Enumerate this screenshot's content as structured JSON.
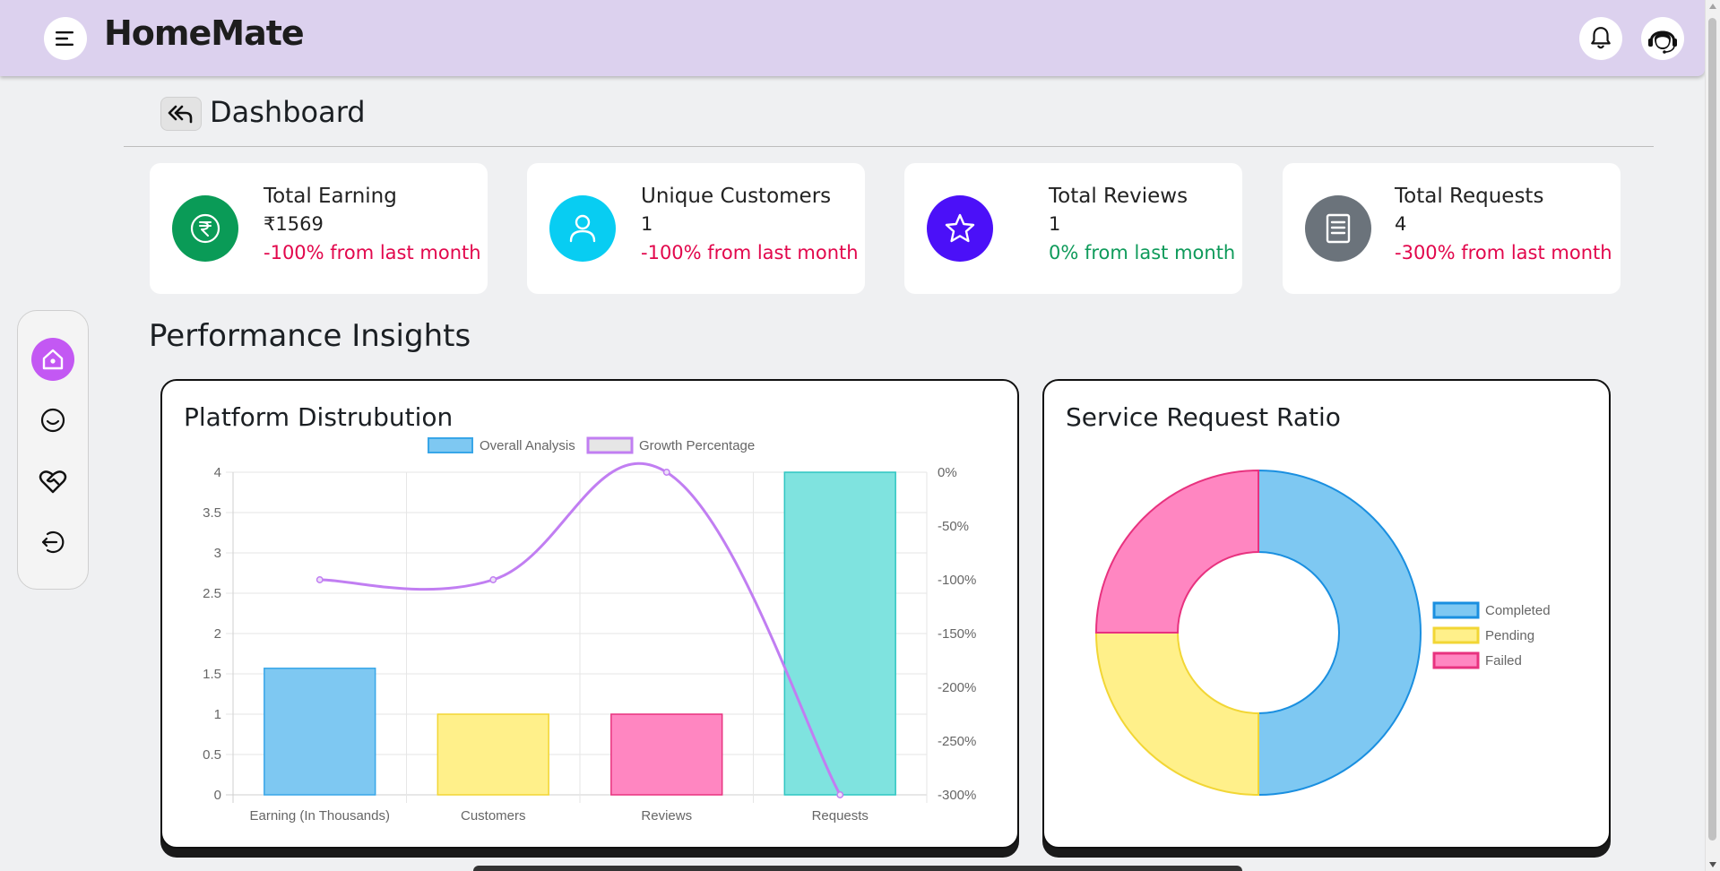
{
  "app": {
    "brand": "HomeMate"
  },
  "header": {
    "menu_icon": "hamburger-icon",
    "bell_icon": "bell-icon",
    "support_icon": "headset-avatar-icon"
  },
  "page": {
    "title": "Dashboard",
    "section_title": "Performance Insights"
  },
  "stats": [
    {
      "label": "Total Earning",
      "value": "₹1569",
      "change": "-100% from last month",
      "icon": "rupee-icon",
      "color": "#0a9b57",
      "change_color": "#e2074c"
    },
    {
      "label": "Unique Customers",
      "value": "1",
      "change": "-100% from last month",
      "icon": "user-icon",
      "color": "#08cdf2",
      "change_color": "#e2074c"
    },
    {
      "label": "Total Reviews",
      "value": "1",
      "change": "0% from last month",
      "icon": "star-icon",
      "color": "#4b10f8",
      "change_color": "#0e9a5a"
    },
    {
      "label": "Total Requests",
      "value": "4",
      "change": "-300% from last month",
      "icon": "document-icon",
      "color": "#6b737b",
      "change_color": "#e2074c"
    }
  ],
  "sidebar": {
    "items": [
      "home-icon",
      "smile-icon",
      "heart-handshake-icon",
      "logout-icon"
    ]
  },
  "charts": {
    "platform_title": "Platform Distrubution",
    "ratio_title": "Service Request Ratio"
  },
  "chart_data": [
    {
      "type": "bar",
      "title": "Platform Distrubution",
      "categories": [
        "Earning (In Thousands)",
        "Customers",
        "Reviews",
        "Requests"
      ],
      "series": [
        {
          "name": "Overall Analysis",
          "type": "bar",
          "values": [
            1.569,
            1,
            1,
            4
          ],
          "colors": [
            "#7ec8f2",
            "#fff08a",
            "#ff86c1",
            "#7fe3df"
          ],
          "borders": [
            "#38a6e8",
            "#f2d635",
            "#e8327f",
            "#2fc6c2"
          ],
          "axis": "left"
        },
        {
          "name": "Growth Percentage",
          "type": "line",
          "values": [
            -100,
            -100,
            0,
            -300
          ],
          "color": "#c17ef2",
          "axis": "right"
        }
      ],
      "left_axis": {
        "ylim": [
          0,
          4
        ],
        "ticks": [
          "0",
          "0.5",
          "1",
          "1.5",
          "2",
          "2.5",
          "3",
          "3.5",
          "4"
        ]
      },
      "right_axis": {
        "ylim": [
          -300,
          0
        ],
        "ticks": [
          "-300%",
          "-250%",
          "-200%",
          "-150%",
          "-100%",
          "-50%",
          "0%"
        ]
      },
      "legend": "top",
      "grid": true
    },
    {
      "type": "pie",
      "title": "Service Request Ratio",
      "labels": [
        "Completed",
        "Pending",
        "Failed"
      ],
      "values": [
        2,
        1,
        1
      ],
      "colors": [
        "#7ec8f2",
        "#fff08a",
        "#ff86c1"
      ],
      "borders": [
        "#1a8fe0",
        "#f2d635",
        "#e8327f"
      ],
      "donut": true,
      "legend": "right"
    }
  ]
}
